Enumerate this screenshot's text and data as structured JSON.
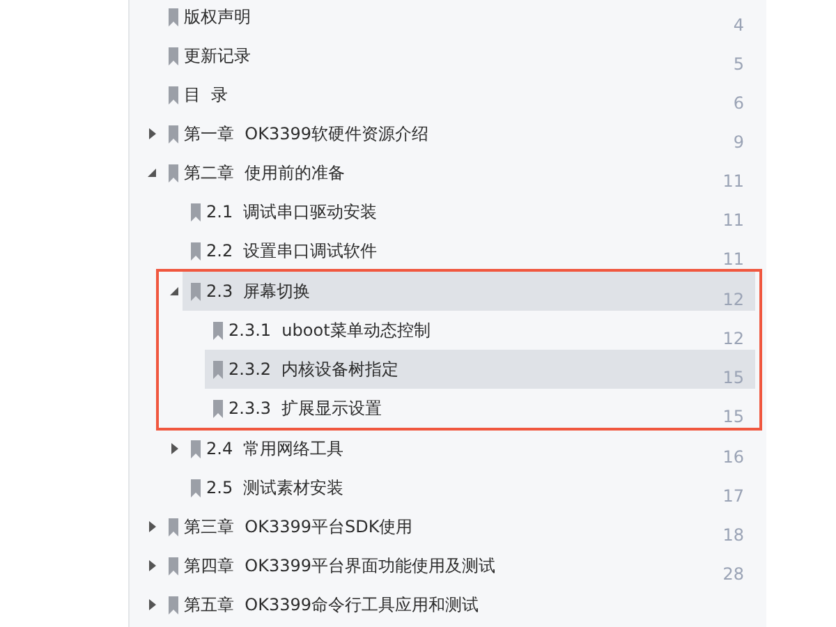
{
  "outline": [
    {
      "label": "版权声明",
      "page": "4",
      "selected": false
    },
    {
      "label": "更新记录",
      "page": "5",
      "selected": false
    },
    {
      "label": "目  录",
      "page": "6",
      "selected": false
    },
    {
      "label": "第一章  OK3399软硬件资源介绍",
      "page": "9",
      "expanded": false,
      "selected": false
    },
    {
      "label": "第二章  使用前的准备",
      "page": "11",
      "expanded": true,
      "selected": false,
      "children": [
        {
          "label": "2.1  调试串口驱动安装",
          "page": "11",
          "selected": false
        },
        {
          "label": "2.2  设置串口调试软件",
          "page": "11",
          "selected": false
        },
        {
          "label": "2.3  屏幕切换",
          "page": "12",
          "expanded": true,
          "selected": true,
          "boxed": true,
          "children": [
            {
              "label": "2.3.1  uboot菜单动态控制",
              "page": "12",
              "selected": false
            },
            {
              "label": "2.3.2  内核设备树指定",
              "page": "15",
              "selected": true
            },
            {
              "label": "2.3.3  扩展显示设置",
              "page": "15",
              "selected": false
            }
          ]
        },
        {
          "label": "2.4  常用网络工具",
          "page": "16",
          "expanded": false,
          "selected": false
        },
        {
          "label": "2.5  测试素材安装",
          "page": "17",
          "selected": false
        }
      ]
    },
    {
      "label": "第三章  OK3399平台SDK使用",
      "page": "18",
      "expanded": false,
      "selected": false
    },
    {
      "label": "第四章  OK3399平台界面功能使用及测试",
      "page": "28",
      "expanded": false,
      "selected": false
    },
    {
      "label": "第五章  OK3399命令行工具应用和测试",
      "expanded": false,
      "selected": false
    }
  ]
}
